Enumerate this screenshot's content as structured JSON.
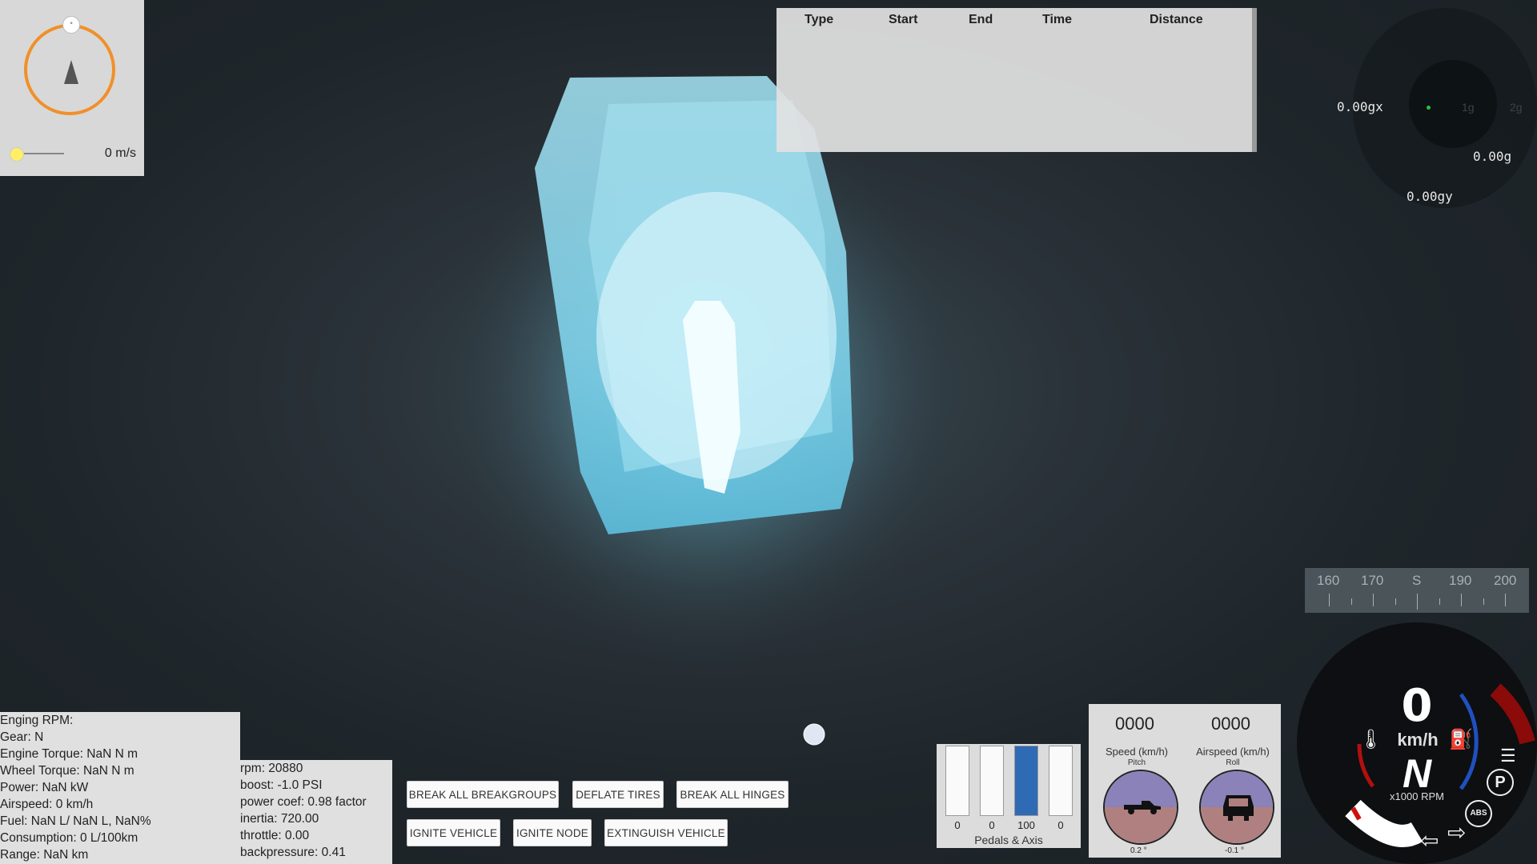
{
  "compass": {
    "knob_glyph": "°",
    "speed_label": "0 m/s",
    "speed_slider_fraction": 0.0
  },
  "trip_table": {
    "columns": [
      "Type",
      "Start",
      "End",
      "Time",
      "Distance"
    ],
    "rows": []
  },
  "gforce": {
    "gx": "0.00gx",
    "gy": "0.00gy",
    "g": "0.00g",
    "ring_label_1": "1g",
    "ring_label_2": "2g"
  },
  "heading_tape": {
    "labels": [
      "160",
      "170",
      "S",
      "190",
      "200"
    ]
  },
  "vehicle_info": {
    "lines": [
      "Enging RPM:",
      "Gear: N",
      "Engine Torque: NaN N m",
      "Wheel Torque: NaN N m",
      "Power: NaN kW",
      "Airspeed: 0 km/h",
      "Fuel: NaN L/ NaN L, NaN%",
      "Consumption: 0 L/100km",
      "Range: NaN km"
    ]
  },
  "engine_info": {
    "lines": [
      "rpm: 20880",
      "boost: -1.0 PSI",
      "power coef: 0.98 factor",
      "inertia: 720.00",
      "throttle: 0.00",
      "backpressure: 0.41"
    ]
  },
  "buttons": {
    "break_breakgroups": "BREAK ALL BREAKGROUPS",
    "deflate_tires": "DEFLATE TIRES",
    "break_hinges": "BREAK ALL HINGES",
    "ignite_vehicle": "IGNITE VEHICLE",
    "ignite_node": "IGNITE NODE",
    "extinguish_vehicle": "EXTINGUISH VEHICLE"
  },
  "pedals": {
    "label": "Pedals & Axis",
    "values": [
      "0",
      "0",
      "100",
      "0"
    ],
    "fill_fractions": [
      0,
      0,
      1.0,
      0
    ],
    "fill_color": "#2f6ab5"
  },
  "attitude": {
    "speed_value": "0000",
    "speed_label": "Speed (km/h)",
    "airspeed_value": "0000",
    "airspeed_label": "Airspeed (km/h)",
    "pitch_label": "Pitch",
    "roll_label": "Roll",
    "pitch_deg": "0.2 °",
    "roll_deg": "-0.1 °"
  },
  "dashboard": {
    "speed": "0",
    "unit": "km/h",
    "gear": "N",
    "rpm_label": "x1000 RPM",
    "icons": [
      "temperature-icon",
      "fuel-icon",
      "headlight-icon",
      "parking-brake-icon",
      "abs-icon",
      "left-signal-icon",
      "right-signal-icon"
    ],
    "abs_label": "ABS",
    "parking_label": "P"
  },
  "colors": {
    "compass_ring": "#f0902a",
    "vehicle_glow": "#7fdcf0",
    "redline": "#8b0a0a",
    "rpm_arc": "#2050c0"
  }
}
